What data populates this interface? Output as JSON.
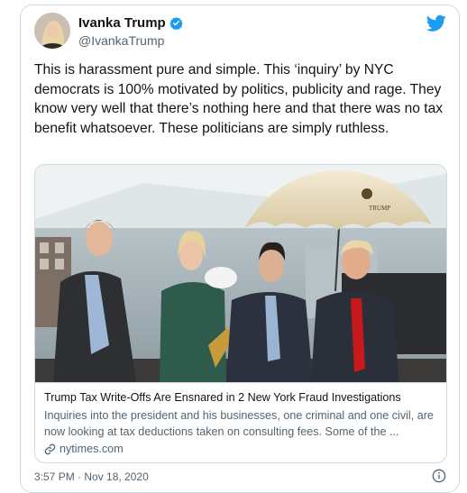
{
  "tweet": {
    "author_name": "Ivanka Trump",
    "author_handle": "@IvankaTrump",
    "text": "This is harassment pure and simple. This ‘inquiry’ by NYC democrats is 100% motivated by politics, publicity and rage. They know very well that there’s nothing here and that there was no tax benefit whatsoever. These politicians are simply ruthless.",
    "footer_partial": "3:57 PM · Nov 18, 2020"
  },
  "link_card": {
    "umbrella_text": "TRUMP",
    "title": "Trump Tax Write-Offs Are Ensnared in 2 New York Fraud Investigations",
    "description": "Inquiries into the president and his businesses, one criminal and one civil, are now looking at tax deductions taken on consulting fees. Some of the ...",
    "domain": "nytimes.com"
  },
  "colors": {
    "twitter_blue": "#1d9bf0",
    "text_primary": "#0f1419",
    "text_secondary": "#536471",
    "border": "#cfd9de"
  },
  "icons": [
    "verified-badge-icon",
    "twitter-bird-icon",
    "link-icon",
    "info-icon"
  ]
}
